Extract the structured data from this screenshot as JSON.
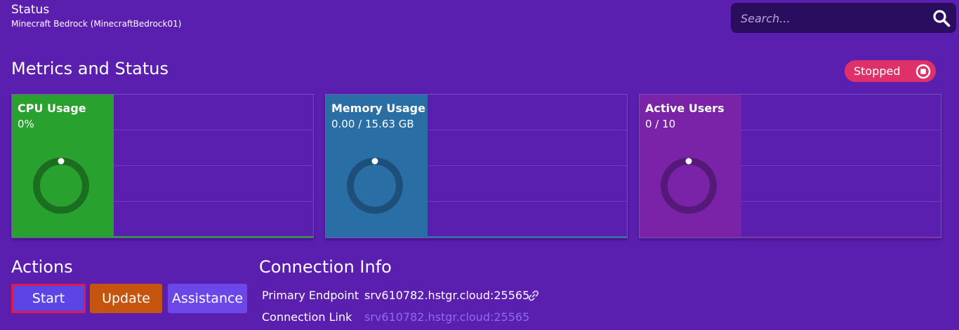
{
  "header": {
    "title": "Status",
    "subtitle": "Minecraft Bedrock (MinecraftBedrock01)"
  },
  "search": {
    "placeholder": "Search...",
    "icon": "search-icon"
  },
  "metrics": {
    "title": "Metrics and Status",
    "status_badge": {
      "label": "Stopped",
      "icon": "stop-icon",
      "color": "#e0306a"
    },
    "cards": [
      {
        "label": "CPU Usage",
        "value": "0%",
        "color": "#28a12e",
        "ring_color": "#1b6e1f",
        "fraction": 0
      },
      {
        "label": "Memory Usage",
        "value": "0.00 / 15.63 GB",
        "color": "#2a6ea6",
        "ring_color": "#1d4f7a",
        "fraction": 0
      },
      {
        "label": "Active Users",
        "value": "0 / 10",
        "color": "#7a23a8",
        "ring_color": "#55197a",
        "fraction": 0
      }
    ]
  },
  "actions": {
    "title": "Actions",
    "start_label": "Start",
    "update_label": "Update",
    "assistance_label": "Assistance"
  },
  "connection": {
    "title": "Connection Info",
    "primary_endpoint_label": "Primary Endpoint",
    "primary_endpoint_value": "srv610782.hstgr.cloud:25565",
    "connection_link_label": "Connection Link",
    "connection_link_value": "srv610782.hstgr.cloud:25565",
    "copy_icon": "link-icon"
  }
}
